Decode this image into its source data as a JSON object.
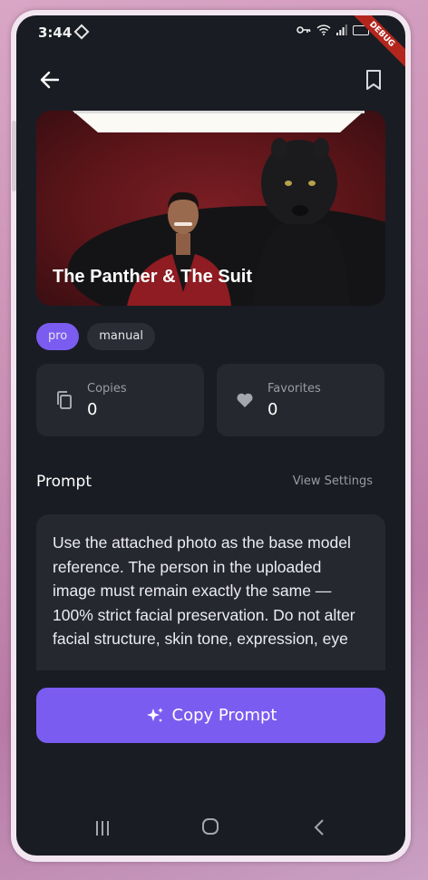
{
  "status_bar": {
    "time": "3:44",
    "debug_label": "DEBUG"
  },
  "header": {
    "back_icon": "arrow-left-icon",
    "bookmark_icon": "bookmark-icon"
  },
  "hero": {
    "title": "The Panther & The Suit"
  },
  "tags": [
    "pro",
    "manual"
  ],
  "stats": {
    "copies": {
      "label": "Copies",
      "value": "0",
      "icon": "copy-icon"
    },
    "favorites": {
      "label": "Favorites",
      "value": "0",
      "icon": "heart-icon"
    }
  },
  "prompt": {
    "title": "Prompt",
    "view_settings_label": "View Settings",
    "text": "Use the attached photo as the base model reference. The person in the uploaded image must remain exactly the same — 100% strict facial preservation. Do not alter facial structure, skin tone, expression, eye"
  },
  "actions": {
    "copy_prompt_label": "Copy Prompt"
  },
  "colors": {
    "accent": "#7b5cf0",
    "background": "#1a1c23",
    "card": "#262830"
  }
}
